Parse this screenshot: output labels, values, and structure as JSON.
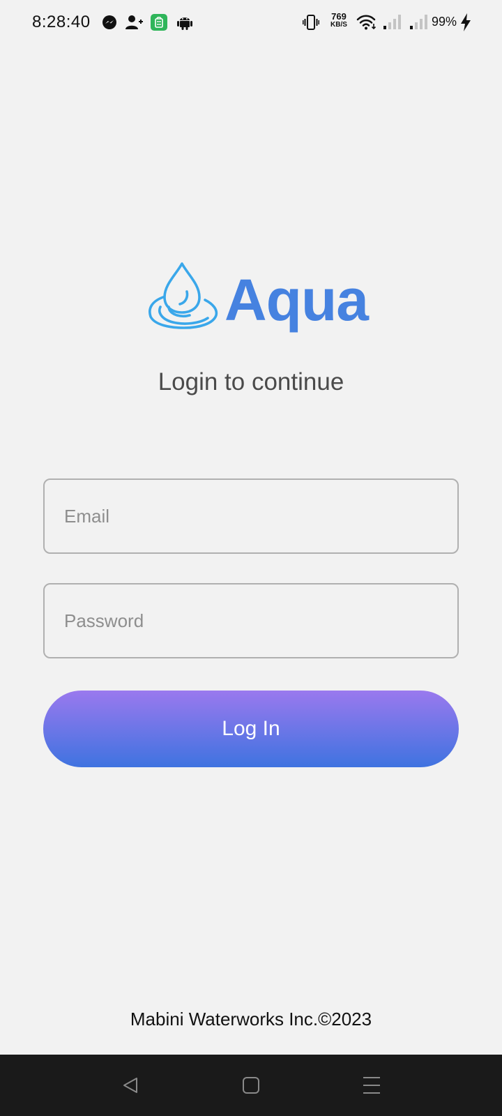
{
  "status_bar": {
    "time": "8:28:40",
    "net_speed": "769",
    "net_speed_unit": "KB/S",
    "battery": "99%",
    "icons": [
      "messenger-icon",
      "add-contact-icon",
      "green-app-icon",
      "android-icon",
      "vibrate-icon",
      "wifi-icon",
      "signal-icon",
      "signal-icon",
      "charging-icon"
    ]
  },
  "app": {
    "logo_text": "Aqua",
    "subtitle": "Login to continue",
    "brand_color": "#4682e0",
    "drop_color": "#3aa7ea"
  },
  "form": {
    "email_placeholder": "Email",
    "email_value": "",
    "password_placeholder": "Password",
    "password_value": "",
    "login_label": "Log In",
    "button_gradient": [
      "#9a79ee",
      "#3f73e0"
    ]
  },
  "footer": {
    "text": "Mabini Waterworks Inc.©2023"
  },
  "nav_bar": {
    "icons": [
      "back-icon",
      "home-icon",
      "menu-icon"
    ]
  }
}
